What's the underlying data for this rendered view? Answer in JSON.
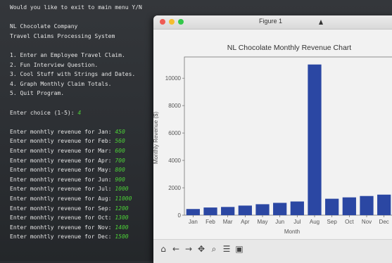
{
  "terminal": {
    "lines": [
      {
        "text": "Would you like to exit to main menu Y/N",
        "value": ""
      },
      {
        "text": "",
        "value": ""
      },
      {
        "text": "NL Chocolate Company",
        "value": ""
      },
      {
        "text": "Travel Claims Processing System",
        "value": ""
      },
      {
        "text": "",
        "value": ""
      },
      {
        "text": "1. Enter an Employee Travel Claim.",
        "value": ""
      },
      {
        "text": "2. Fun Interview Question.",
        "value": ""
      },
      {
        "text": "3. Cool Stuff with Strings and Dates.",
        "value": ""
      },
      {
        "text": "4. Graph Monthly Claim Totals.",
        "value": ""
      },
      {
        "text": "5. Quit Program.",
        "value": ""
      },
      {
        "text": "",
        "value": ""
      },
      {
        "text": "Enter choice (1-5): ",
        "value": "4"
      },
      {
        "text": "",
        "value": ""
      },
      {
        "text": "Enter monhtly revenue for Jan: ",
        "value": "450"
      },
      {
        "text": "Enter monhtly revenue for Feb: ",
        "value": "560"
      },
      {
        "text": "Enter monhtly revenue for Mar: ",
        "value": "600"
      },
      {
        "text": "Enter monhtly revenue for Apr: ",
        "value": "700"
      },
      {
        "text": "Enter monhtly revenue for May: ",
        "value": "800"
      },
      {
        "text": "Enter monhtly revenue for Jun: ",
        "value": "900"
      },
      {
        "text": "Enter monhtly revenue for Jul: ",
        "value": "1000"
      },
      {
        "text": "Enter monhtly revenue for Aug: ",
        "value": "11000"
      },
      {
        "text": "Enter monhtly revenue for Sep: ",
        "value": "1200"
      },
      {
        "text": "Enter monhtly revenue for Oct: ",
        "value": "1300"
      },
      {
        "text": "Enter monhtly revenue for Nov: ",
        "value": "1400"
      },
      {
        "text": "Enter monhtly revenue for Dec: ",
        "value": "1500"
      }
    ]
  },
  "window": {
    "title": "Figure 1",
    "toolbar_icons": [
      "home-icon",
      "back-arrow-icon",
      "forward-arrow-icon",
      "pan-icon",
      "zoom-icon",
      "configure-subplots-icon",
      "save-icon"
    ]
  },
  "colors": {
    "bar": "#2b47a3",
    "terminal_text": "#e6e6e6",
    "input_value": "#4cd137"
  },
  "chart_data": {
    "type": "bar",
    "title": "NL Chocolate Monthly Revenue Chart",
    "xlabel": "Month",
    "ylabel": "Monthly Revenue ($)",
    "categories": [
      "Jan",
      "Feb",
      "Mar",
      "Apr",
      "May",
      "Jun",
      "Jul",
      "Aug",
      "Sep",
      "Oct",
      "Nov",
      "Dec"
    ],
    "values": [
      450,
      560,
      600,
      700,
      800,
      900,
      1000,
      11000,
      1200,
      1300,
      1400,
      1500
    ],
    "yticks": [
      0,
      2000,
      4000,
      6000,
      8000,
      10000
    ],
    "ylim": [
      0,
      11550
    ],
    "grid": false
  }
}
